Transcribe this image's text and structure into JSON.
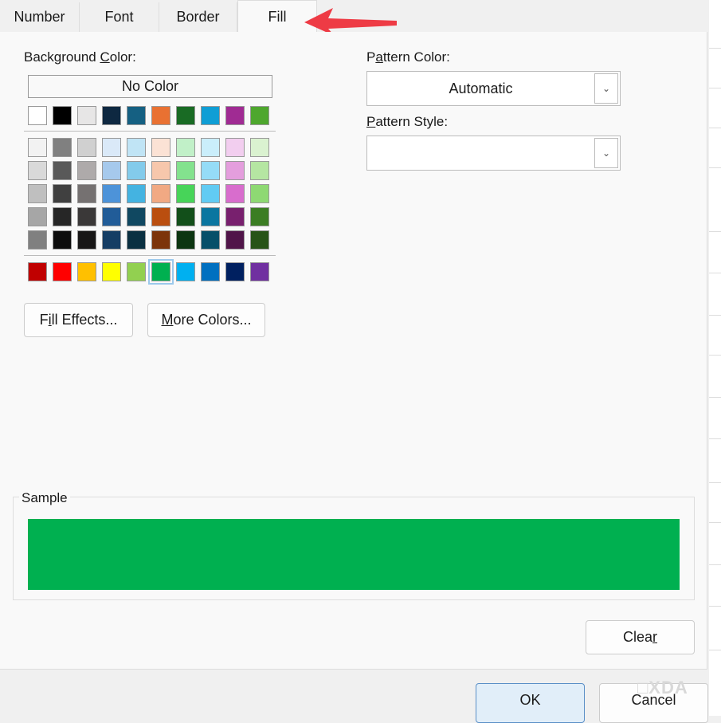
{
  "tabs": [
    {
      "label": "Number"
    },
    {
      "label": "Font"
    },
    {
      "label": "Border"
    },
    {
      "label": "Fill",
      "active": true
    }
  ],
  "background_color": {
    "pre": "Background ",
    "key": "C",
    "post": "olor:"
  },
  "no_color": "No Color",
  "theme_row": [
    "#ffffff",
    "#000000",
    "#e7e6e6",
    "#0e2841",
    "#156082",
    "#e97132",
    "#196b24",
    "#0f9ed5",
    "#a02b93",
    "#4ea72e"
  ],
  "shade_rows": [
    [
      "#f2f2f2",
      "#808080",
      "#d0d0d0",
      "#dae9f8",
      "#c0e4f5",
      "#fbe2d5",
      "#c1f0c8",
      "#caeefb",
      "#f2ceef",
      "#daf2d0"
    ],
    [
      "#d9d9d9",
      "#595959",
      "#aeaaaa",
      "#a6c9ec",
      "#83cbeb",
      "#f7c7ac",
      "#83e28e",
      "#95dcf7",
      "#e49edd",
      "#b5e6a2"
    ],
    [
      "#bfbfbf",
      "#404040",
      "#757171",
      "#4d93d9",
      "#44b3e1",
      "#f1a983",
      "#47d459",
      "#61cbf3",
      "#d86dcd",
      "#8ed973"
    ],
    [
      "#a6a6a6",
      "#262626",
      "#3a3838",
      "#215c98",
      "#104861",
      "#ba4e0f",
      "#124f1a",
      "#0b76a0",
      "#78206e",
      "#3b7d23"
    ],
    [
      "#808080",
      "#0d0d0d",
      "#171616",
      "#153d64",
      "#0a3041",
      "#7c340a",
      "#0c3511",
      "#074f69",
      "#501549",
      "#275317"
    ]
  ],
  "standard_row": [
    "#c00000",
    "#ff0000",
    "#ffc000",
    "#ffff00",
    "#92d050",
    "#00b050",
    "#00b0f0",
    "#0070c0",
    "#002060",
    "#7030a0"
  ],
  "selected_color": "#00b050",
  "fill_effects": {
    "pre": "F",
    "key": "i",
    "post": "ll Effects..."
  },
  "more_colors": {
    "pre": "",
    "key": "M",
    "post": "ore Colors..."
  },
  "pattern_color": {
    "pre": "P",
    "key": "a",
    "post": "ttern Color:",
    "value": "Automatic"
  },
  "pattern_style": {
    "pre": "",
    "key": "P",
    "post": "attern Style:",
    "value": ""
  },
  "sample_label": "Sample",
  "clear": {
    "pre": "Clea",
    "key": "r",
    "post": ""
  },
  "ok": "OK",
  "cancel": "Cancel",
  "watermark": "XDA"
}
